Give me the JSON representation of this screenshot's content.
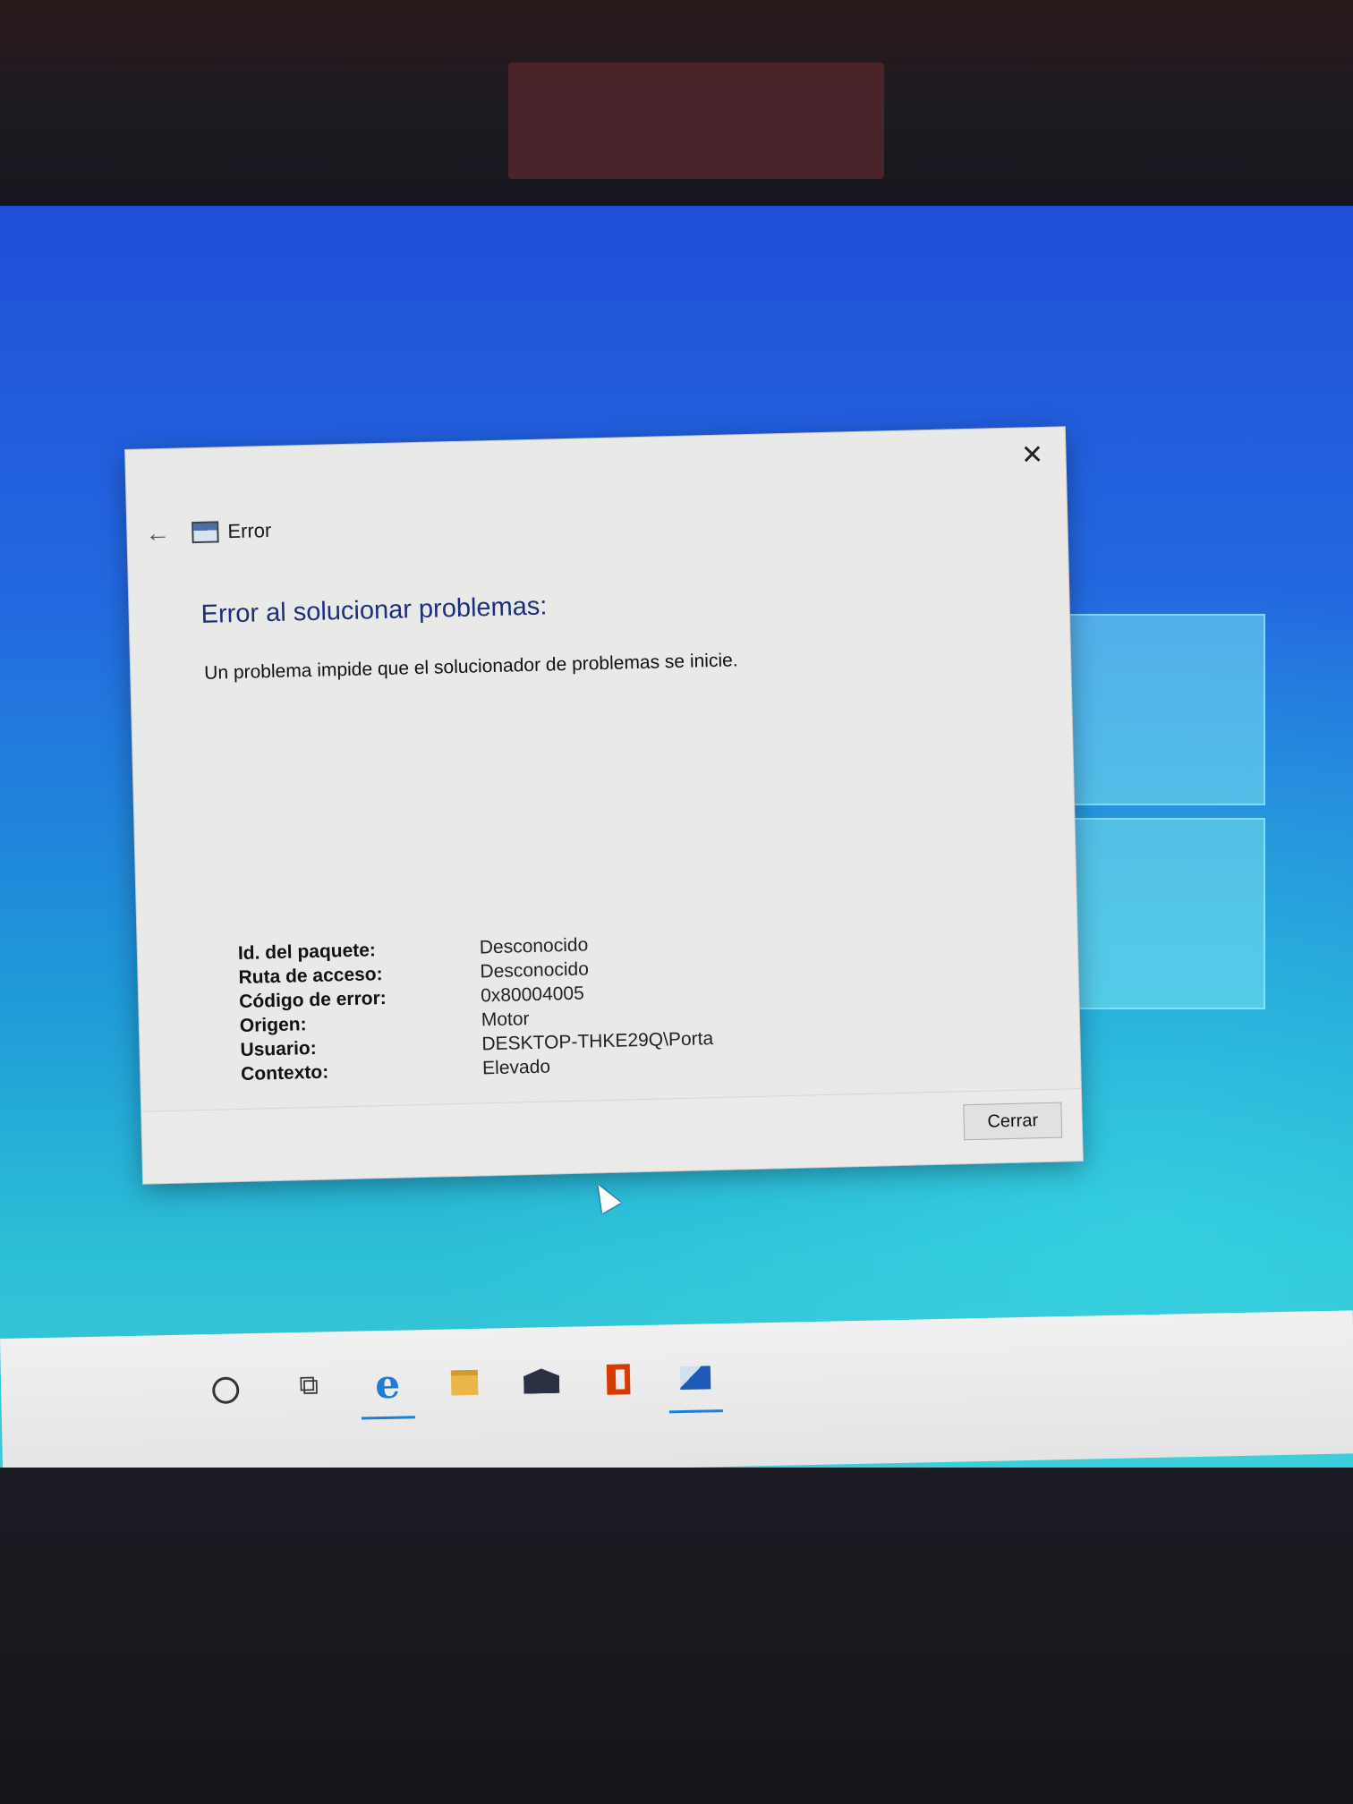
{
  "dialog": {
    "window_title": "Error",
    "close_glyph": "✕",
    "back_glyph": "←",
    "heading": "Error al solucionar problemas:",
    "description": "Un problema impide que el solucionador de problemas se inicie.",
    "details": [
      {
        "label": "Id. del paquete:",
        "value": "Desconocido"
      },
      {
        "label": "Ruta de acceso:",
        "value": "Desconocido"
      },
      {
        "label": "Código de error:",
        "value": "0x80004005"
      },
      {
        "label": "Origen:",
        "value": "Motor"
      },
      {
        "label": "Usuario:",
        "value": "DESKTOP-THKE29Q\\Porta"
      },
      {
        "label": "Contexto:",
        "value": "Elevado"
      }
    ],
    "close_button_label": "Cerrar"
  },
  "taskbar": {
    "items": [
      {
        "icon": "search-circle-icon"
      },
      {
        "icon": "task-view-icon",
        "glyph": "⧉"
      },
      {
        "icon": "edge-icon",
        "glyph": "e"
      },
      {
        "icon": "file-explorer-icon"
      },
      {
        "icon": "mail-icon"
      },
      {
        "icon": "office-icon"
      },
      {
        "icon": "photos-icon"
      }
    ]
  },
  "colors": {
    "heading": "#1b2f7a",
    "desktop_top": "#1f4fd8",
    "desktop_bottom": "#3fc9d6",
    "dialog_bg": "#e9e9e7"
  }
}
